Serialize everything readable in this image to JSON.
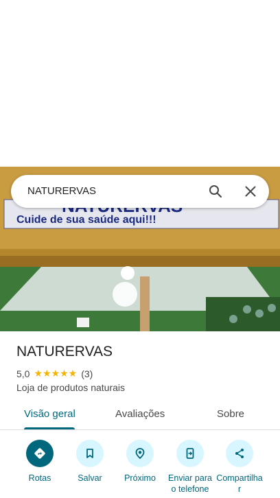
{
  "search": {
    "query": "NATURERVAS"
  },
  "photo": {
    "sign_main": "NATURERVAS",
    "sign_sub": "Cuide de sua saúde aqui!!!"
  },
  "place": {
    "name": "NATURERVAS",
    "rating": "5,0",
    "stars": "★★★★★",
    "reviews": "(3)",
    "category": "Loja de produtos naturais"
  },
  "tabs": [
    {
      "label": "Visão geral",
      "active": true
    },
    {
      "label": "Avaliações",
      "active": false
    },
    {
      "label": "Sobre",
      "active": false
    }
  ],
  "actions": [
    {
      "label": "Rotas",
      "icon": "directions-icon"
    },
    {
      "label": "Salvar",
      "icon": "bookmark-icon"
    },
    {
      "label": "Próximo",
      "icon": "nearby-icon"
    },
    {
      "label": "Enviar para o telefone",
      "icon": "send-to-phone-icon"
    },
    {
      "label": "Compartilhar",
      "icon": "share-icon"
    }
  ],
  "colors": {
    "accent": "#00677d",
    "accent_light": "#d8f6ff",
    "star": "#f4b400"
  }
}
